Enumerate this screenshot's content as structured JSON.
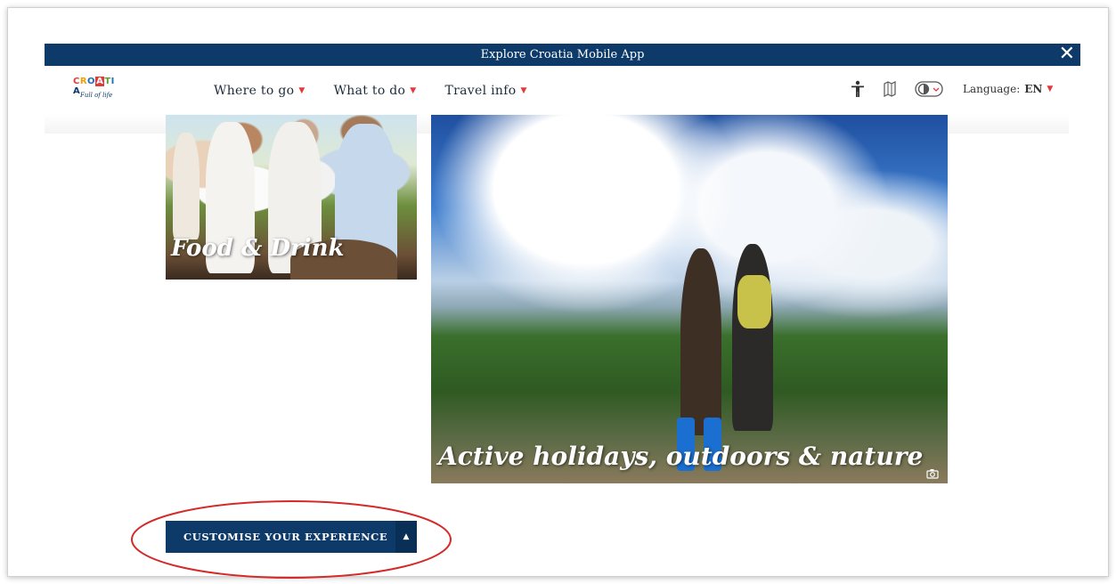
{
  "banner": {
    "text": "Explore Croatia Mobile App",
    "close_icon": "close-icon"
  },
  "logo": {
    "word_letters": [
      "C",
      "R",
      "O",
      "A",
      "T",
      "I",
      "A"
    ],
    "tagline": "Full of life",
    "colors": [
      "#e23a3a",
      "#f2a000",
      "#1d6fb8",
      "#0d3a68",
      "#5aa02c",
      "#1d6fb8",
      "#0d3a68"
    ]
  },
  "nav": {
    "items": [
      {
        "label": "Where to go"
      },
      {
        "label": "What to do"
      },
      {
        "label": "Travel info"
      }
    ]
  },
  "tools": {
    "icons": [
      "accessibility-icon",
      "map-icon",
      "contrast-toggle-icon"
    ],
    "language_label": "Language:",
    "language_value": "EN"
  },
  "tiles": [
    {
      "label": "Food & Drink"
    },
    {
      "label": "Active holidays, outdoors & nature"
    }
  ],
  "customise": {
    "label": "CUSTOMISE YOUR EXPERIENCE",
    "toggle_icon": "caret-up-icon"
  },
  "colors": {
    "brand_navy": "#0d3a68",
    "accent_red": "#e23a3a",
    "annotation_red": "#d42a2a"
  }
}
